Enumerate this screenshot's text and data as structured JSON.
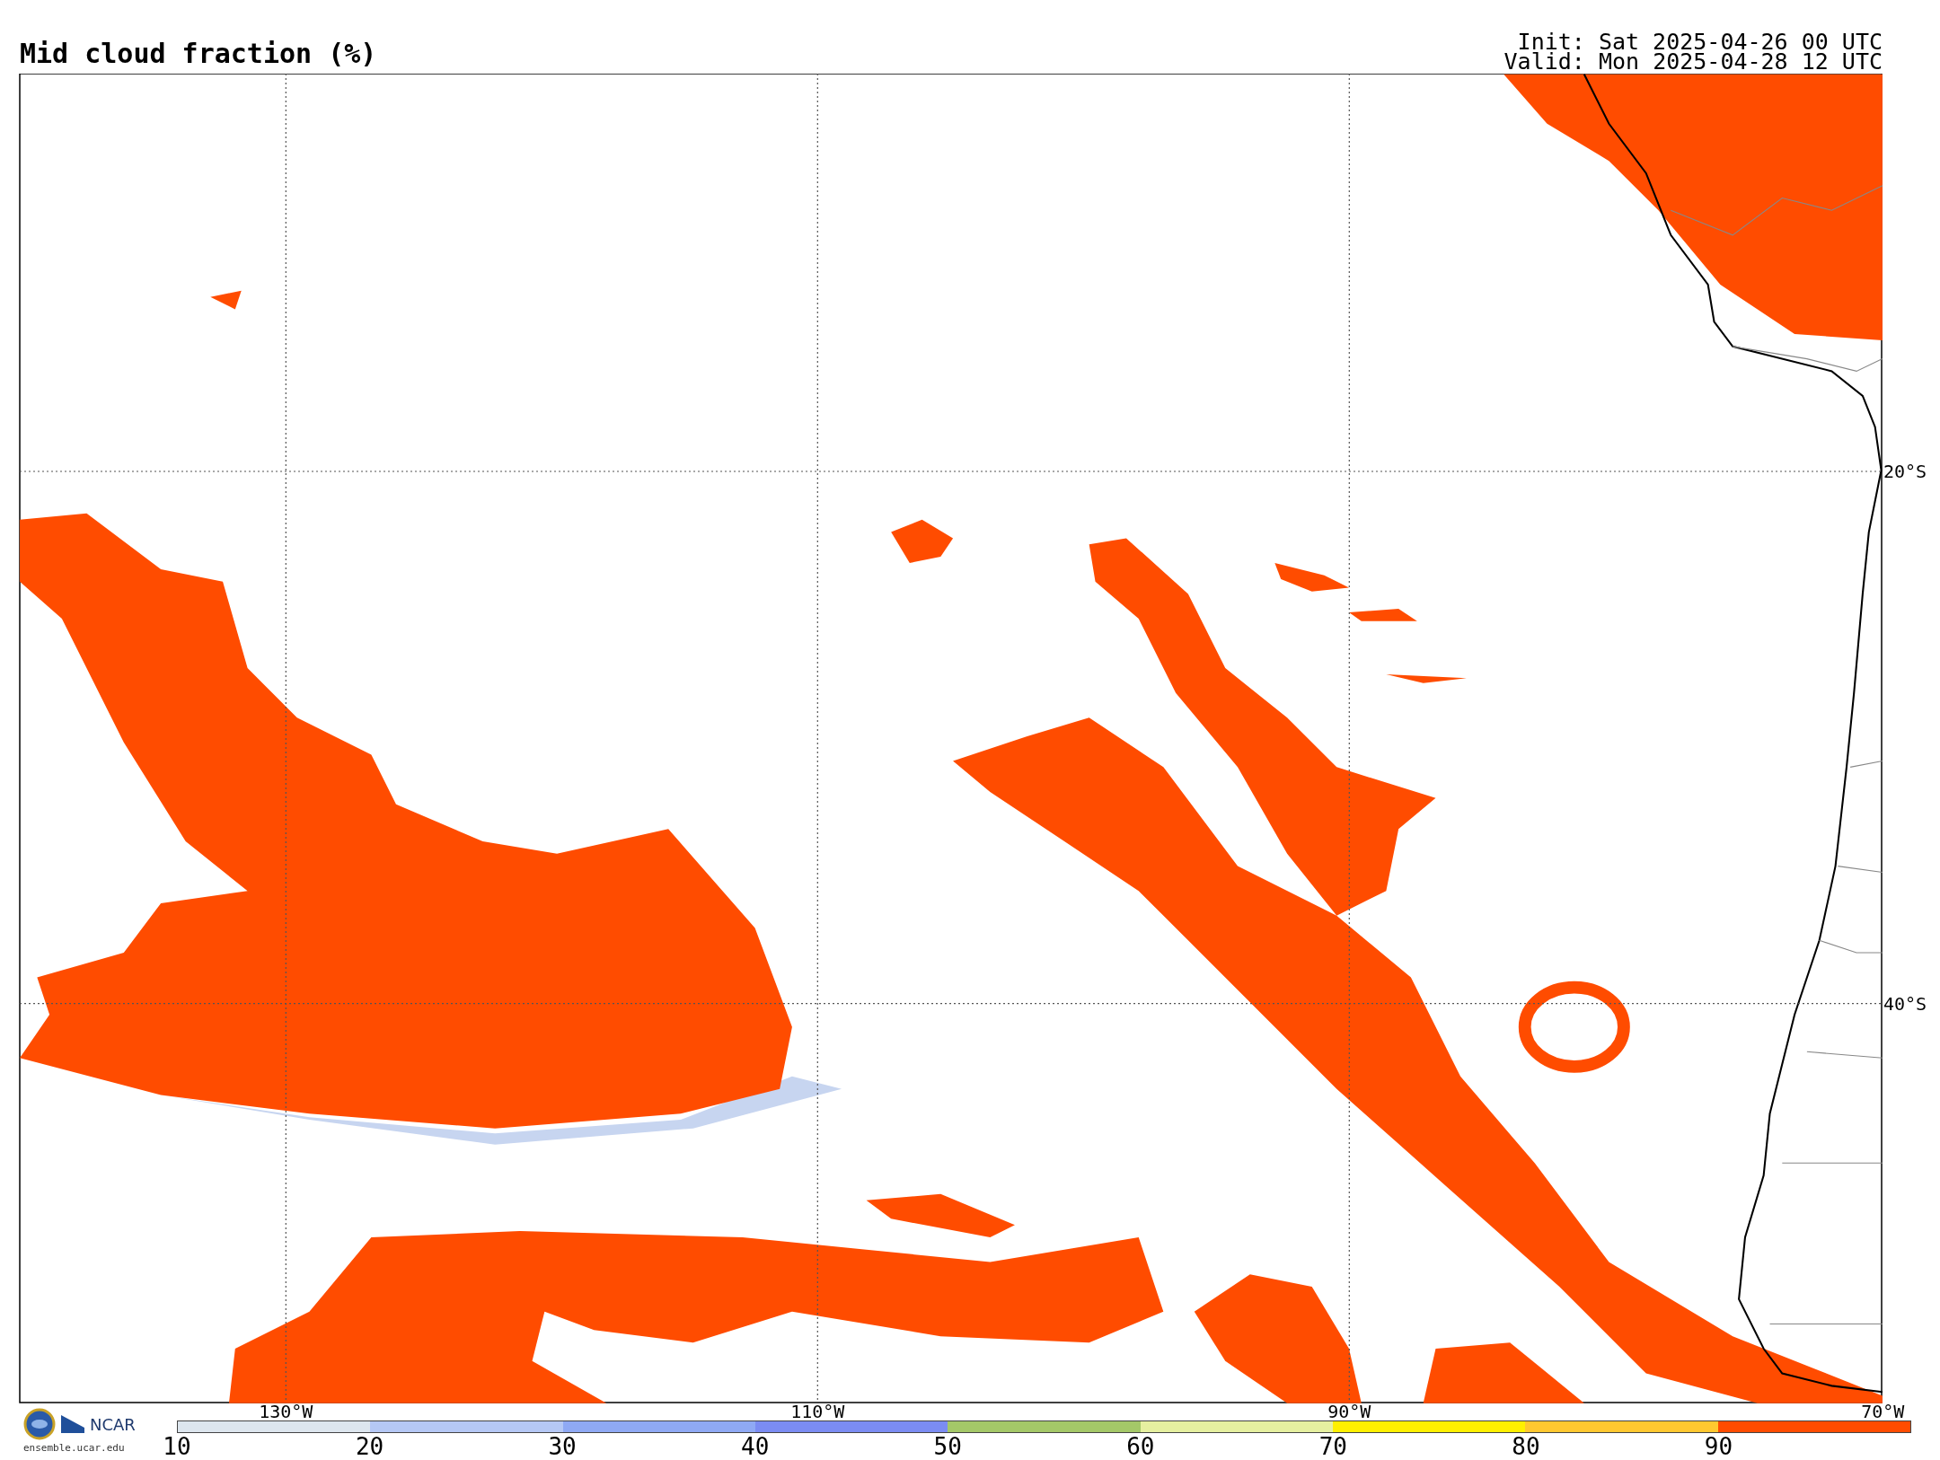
{
  "title": "Mid cloud fraction (%)",
  "init": "Init: Sat 2025-04-26 00 UTC",
  "valid": "Valid: Mon 2025-04-28 12 UTC",
  "map": {
    "lon_labels": [
      "130°W",
      "110°W",
      "90°W",
      "70°W"
    ],
    "lat_labels": [
      "20°S",
      "40°S"
    ]
  },
  "colorbar": {
    "segments": [
      {
        "color": "#dde6ee",
        "label": "10"
      },
      {
        "color": "#b5c8f5",
        "label": "20"
      },
      {
        "color": "#8fa9f4",
        "label": "30"
      },
      {
        "color": "#7b8cf2",
        "label": "40"
      },
      {
        "color": "#a4c868",
        "label": "50"
      },
      {
        "color": "#e6f0a0",
        "label": "60"
      },
      {
        "color": "#fff000",
        "label": "70"
      },
      {
        "color": "#ffc830",
        "label": "80"
      },
      {
        "color": "#ff4c00",
        "label": "90"
      }
    ]
  },
  "logo": {
    "org": "NCAR",
    "url": "ensemble.ucar.edu"
  }
}
